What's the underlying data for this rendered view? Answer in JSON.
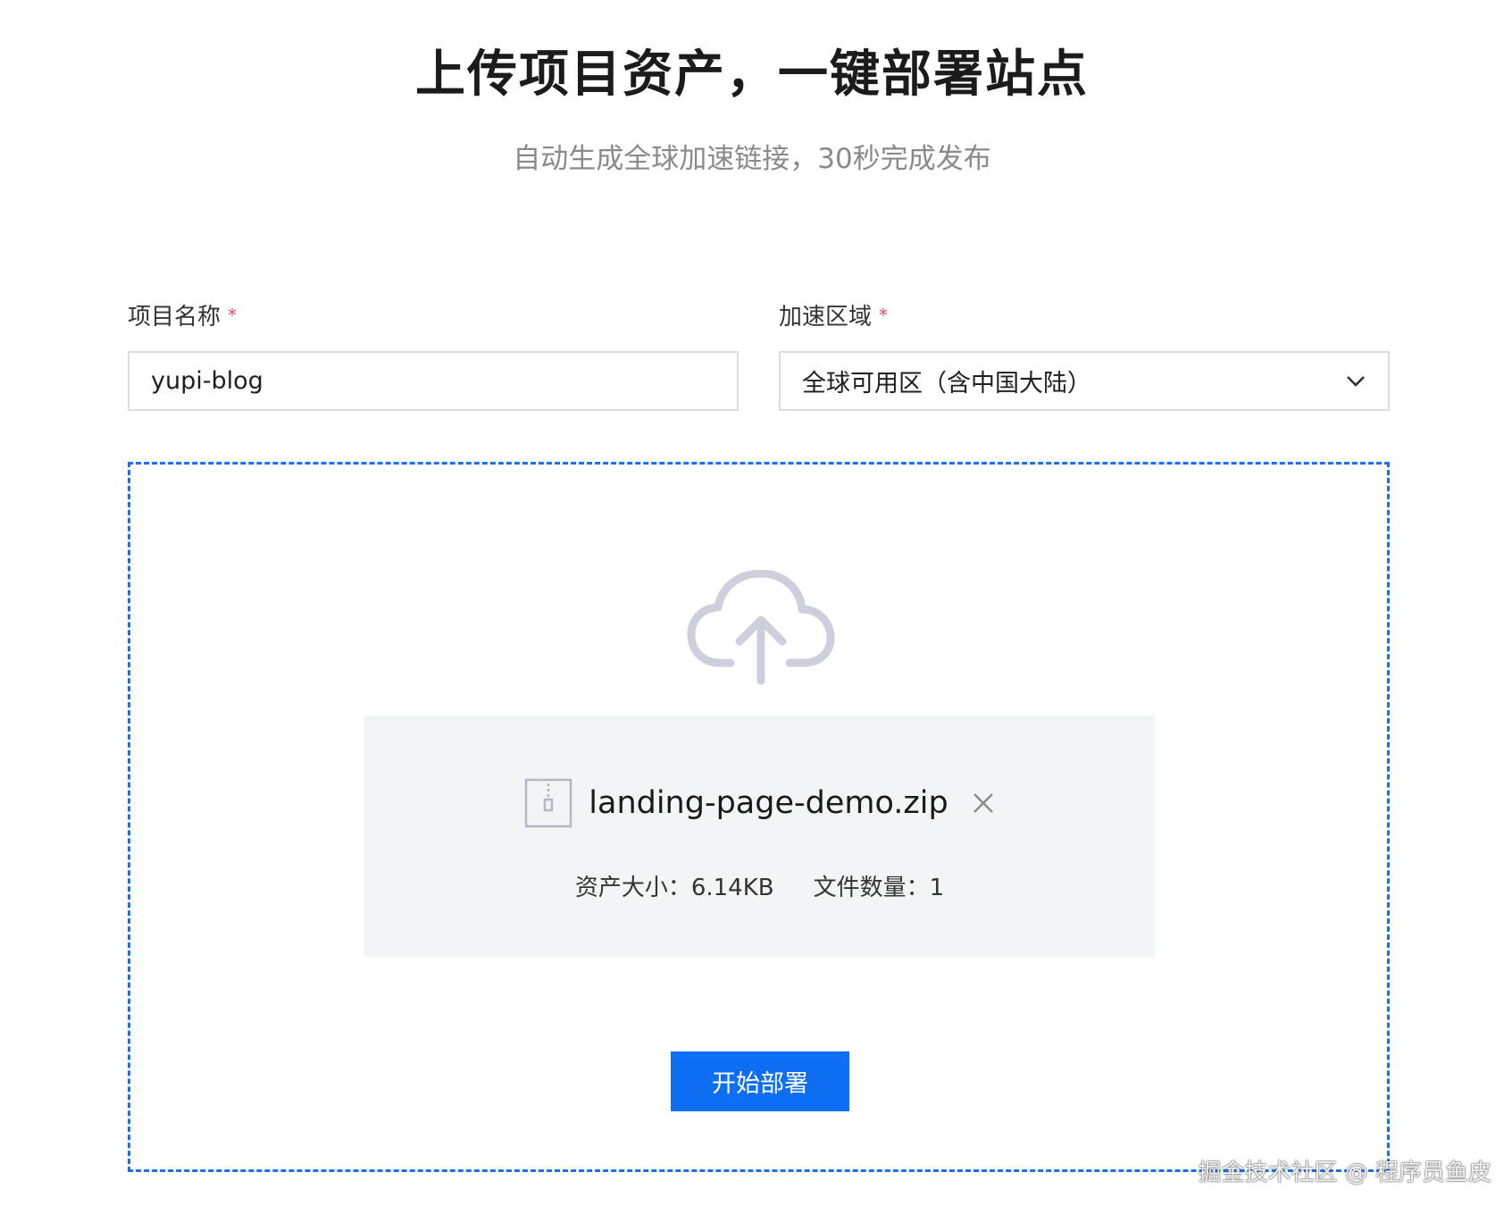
{
  "header": {
    "title": "上传项目资产，一键部署站点",
    "subtitle": "自动生成全球加速链接，30秒完成发布"
  },
  "form": {
    "project_name": {
      "label": "项目名称",
      "required_mark": "*",
      "value": "yupi-blog"
    },
    "region": {
      "label": "加速区域",
      "required_mark": "*",
      "selected": "全球可用区（含中国大陆）",
      "icon": "chevron-down-icon"
    }
  },
  "upload": {
    "icon": "cloud-upload-icon",
    "file": {
      "icon": "zip-file-icon",
      "name": "landing-page-demo.zip",
      "remove_icon": "close-icon",
      "size_text": "资产大小：6.14KB",
      "count_text": "文件数量：1"
    },
    "deploy_label": "开始部署"
  },
  "watermark": "掘金技术社区 @ 程序员鱼皮",
  "colors": {
    "accent": "#0f6ff4",
    "dashed_border": "#1a6ef0",
    "required": "#e34d59",
    "card_bg": "#f3f4f6"
  }
}
